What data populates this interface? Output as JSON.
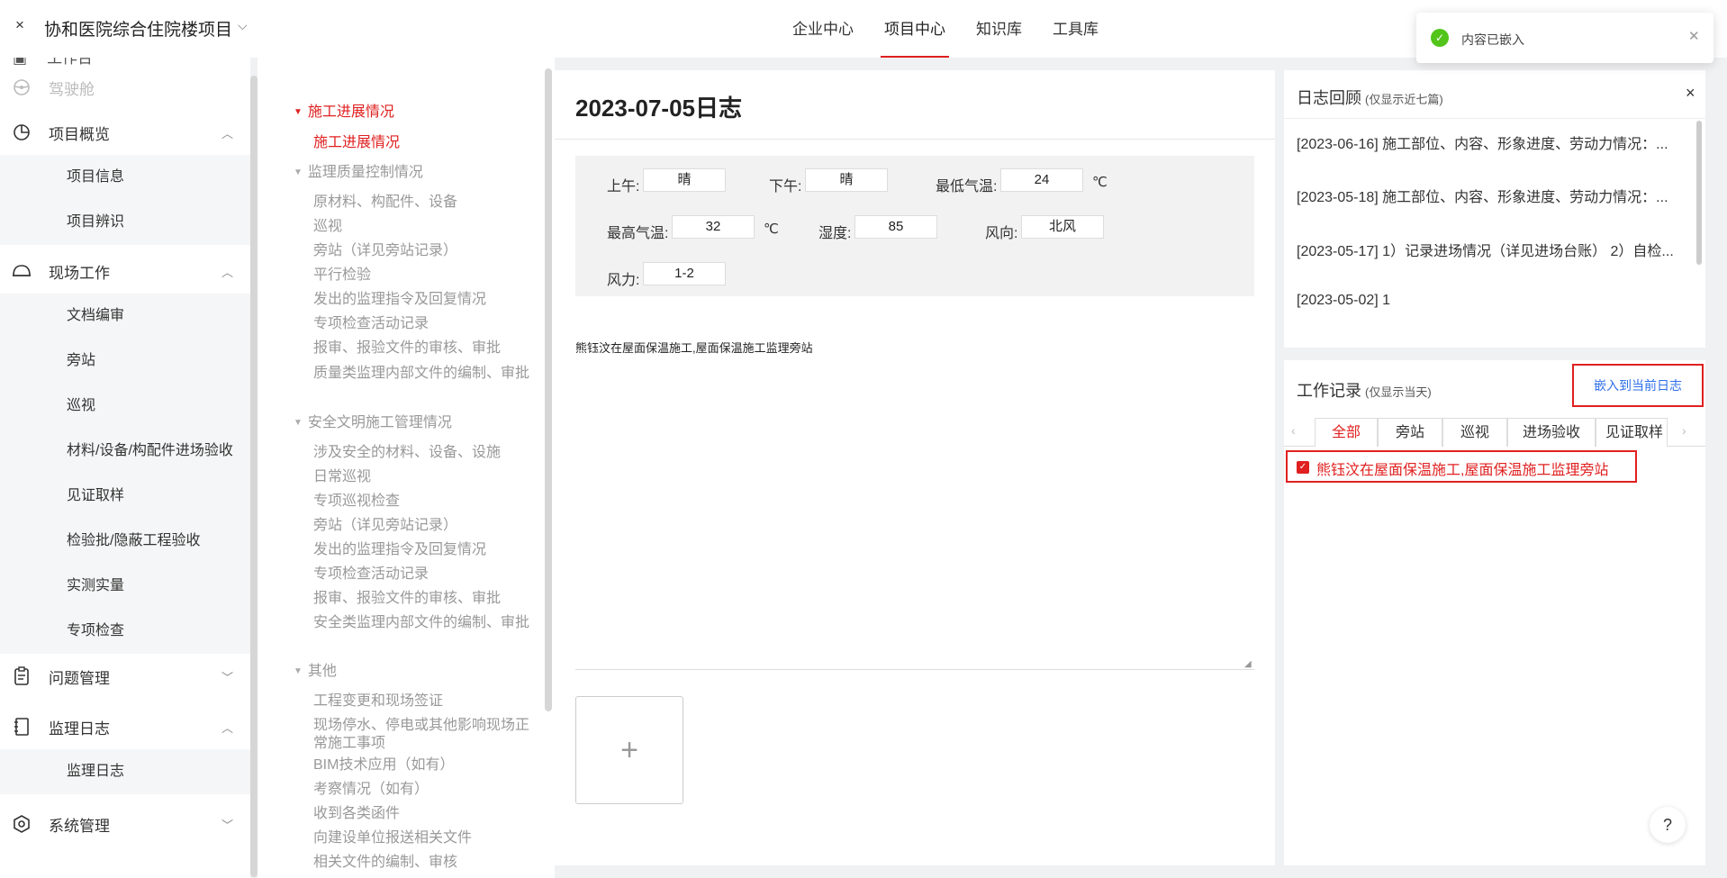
{
  "header": {
    "project_name": "协和医院综合住院楼项目",
    "nav": [
      "企业中心",
      "项目中心",
      "知识库",
      "工具库"
    ]
  },
  "sidebar": {
    "cut_item": "工作台",
    "cockpit": "驾驶舱",
    "overview": "项目概览",
    "overview_items": [
      "项目信息",
      "项目辨识"
    ],
    "site_work": "现场工作",
    "site_items": [
      "文档编审",
      "旁站",
      "巡视",
      "材料/设备/构配件进场验收",
      "见证取样",
      "检验批/隐蔽工程验收",
      "实测实量",
      "专项检查"
    ],
    "issues": "问题管理",
    "journal": "监理日志",
    "journal_items": [
      "监理日志"
    ],
    "system": "系统管理"
  },
  "outline": {
    "s1": "施工进展情况",
    "s1_items": [
      "施工进展情况"
    ],
    "s2": "监理质量控制情况",
    "s2_items": [
      "原材料、构配件、设备",
      "巡视",
      "旁站（详见旁站记录）",
      "平行检验",
      "发出的监理指令及回复情况",
      "专项检查活动记录",
      "报审、报验文件的审核、审批",
      "质量类监理内部文件的编制、审批"
    ],
    "s3": "安全文明施工管理情况",
    "s3_items": [
      "涉及安全的材料、设备、设施",
      "日常巡视",
      "专项巡视检查",
      "旁站（详见旁站记录）",
      "发出的监理指令及回复情况",
      "专项检查活动记录",
      "报审、报验文件的审核、审批",
      "安全类监理内部文件的编制、审批"
    ],
    "s4": "其他",
    "s4_items": [
      "工程变更和现场签证",
      "现场停水、停电或其他影响现场正常施工事项",
      "BIM技术应用（如有）",
      "考察情况（如有）",
      "收到各类函件",
      "向建设单位报送相关文件",
      "相关文件的编制、审核"
    ]
  },
  "editor": {
    "title": "2023-07-05日志",
    "am_label": "上午:",
    "am_value": "晴",
    "pm_label": "下午:",
    "pm_value": "晴",
    "min_label": "最低气温:",
    "min_value": "24",
    "max_label": "最高气温:",
    "max_value": "32",
    "unit": "℃",
    "humidity_label": "湿度:",
    "humidity_value": "85",
    "wind_dir_label": "风向:",
    "wind_dir_value": "北风",
    "wind_label": "风力:",
    "wind_value": "1-2",
    "content": "熊钰汶在屋面保温施工,屋面保温施工监理旁站",
    "upload_symbol": "+"
  },
  "review": {
    "title": "日志回顾",
    "hint": "(仅显示近七篇)",
    "close": "×",
    "items": [
      "[2023-06-16] 施工部位、内容、形象进度、劳动力情况：...",
      "[2023-05-18] 施工部位、内容、形象进度、劳动力情况：...",
      "[2023-05-17] 1）记录进场情况（详见进场台账） 2）自检...",
      "[2023-05-02] 1"
    ]
  },
  "records": {
    "title": "工作记录",
    "hint": "(仅显示当天)",
    "embed": "嵌入到当前日志",
    "tabs": [
      "全部",
      "旁站",
      "巡视",
      "进场验收",
      "见证取样"
    ],
    "item": "熊钰汶在屋面保温施工,屋面保温施工监理旁站"
  },
  "toast": {
    "message": "内容已嵌入"
  },
  "help": "?",
  "colors": {
    "accent": "#e02020",
    "link": "#2f6fea",
    "success": "#52c41a"
  }
}
